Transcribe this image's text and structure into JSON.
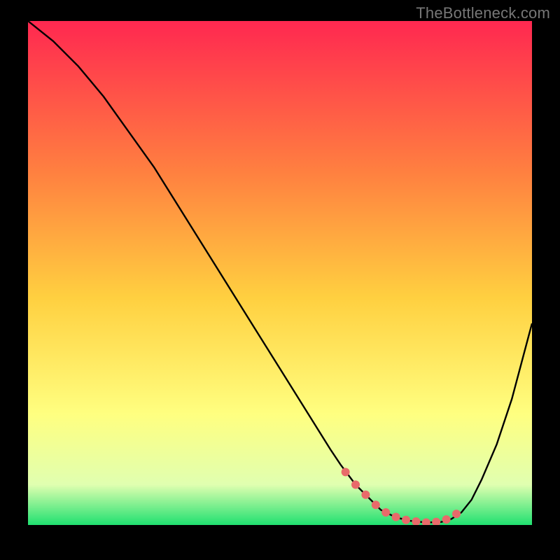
{
  "watermark": "TheBottleneck.com",
  "chart_data": {
    "type": "line",
    "title": "",
    "xlabel": "",
    "ylabel": "",
    "xlim": [
      0,
      100
    ],
    "ylim": [
      0,
      100
    ],
    "grid": false,
    "legend": false,
    "background_gradient": {
      "top": "#FF2850",
      "mid1": "#FF8040",
      "mid2": "#FFD040",
      "mid3": "#FFFF80",
      "mid4": "#E0FFB0",
      "bottom": "#20E070"
    },
    "series": [
      {
        "name": "curve",
        "color": "#000000",
        "x": [
          0,
          5,
          10,
          15,
          20,
          25,
          30,
          35,
          40,
          45,
          50,
          55,
          60,
          62,
          65,
          68,
          70,
          73,
          76,
          79,
          82,
          84,
          86,
          88,
          90,
          93,
          96,
          100
        ],
        "y": [
          100,
          96,
          91,
          85,
          78,
          71,
          63,
          55,
          47,
          39,
          31,
          23,
          15,
          12,
          8,
          5,
          3,
          1.5,
          0.8,
          0.5,
          0.6,
          1.2,
          2.5,
          5,
          9,
          16,
          25,
          40
        ]
      }
    ],
    "markers": {
      "name": "highlight-dots",
      "color": "#E86A6A",
      "r": 6,
      "x": [
        63,
        65,
        67,
        69,
        71,
        73,
        75,
        77,
        79,
        81,
        83,
        85
      ],
      "y": [
        10.5,
        8,
        6,
        4,
        2.5,
        1.6,
        1.0,
        0.7,
        0.5,
        0.6,
        1.1,
        2.2
      ]
    }
  }
}
